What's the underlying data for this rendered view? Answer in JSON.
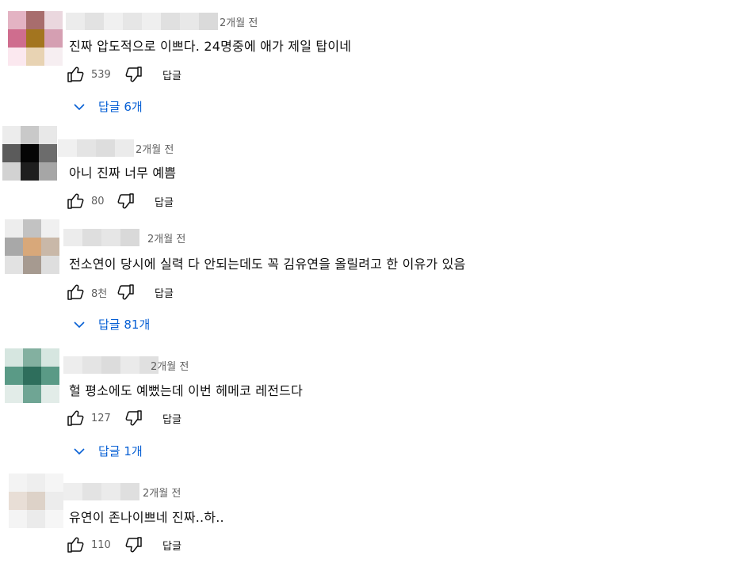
{
  "colors": {
    "link": "#065fd4",
    "meta": "#606060",
    "text": "#0f0f0f"
  },
  "icons": {
    "like": "thumbs-up-icon",
    "dislike": "thumbs-down-icon",
    "expand": "chevron-down-icon"
  },
  "comments": [
    {
      "time": "2개월 전",
      "text": "진짜 압도적으로 이쁘다. 24명중에 애가 제일 탑이네",
      "likes": "539",
      "reply_label": "답글",
      "replies": "답글 6개"
    },
    {
      "time": "2개월 전",
      "text": "아니 진짜 너무 예쁨",
      "likes": "80",
      "reply_label": "답글"
    },
    {
      "time": "2개월 전",
      "text": "전소연이 당시에 실력 다 안되는데도 꼭 김유연을 올릴려고 한 이유가 있음",
      "likes": "8천",
      "reply_label": "답글",
      "replies": "답글 81개"
    },
    {
      "time": "2개월 전",
      "text": "헐 평소에도 예뻤는데 이번 헤메코 레전드다",
      "likes": "127",
      "reply_label": "답글",
      "replies": "답글 1개"
    },
    {
      "time": "2개월 전",
      "text": "유연이 존나이쁘네 진짜..하..",
      "likes": "110",
      "reply_label": "답글"
    }
  ]
}
